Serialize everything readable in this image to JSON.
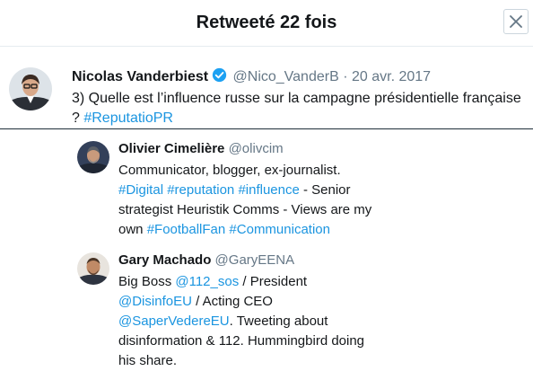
{
  "modal": {
    "title": "Retweeté 22 fois",
    "close_label": "×"
  },
  "tweet": {
    "author_name": "Nicolas Vanderbiest",
    "handle": "@Nico_VanderB",
    "separator": "·",
    "date": "20 avr. 2017",
    "text": "3) Quelle est l’influence russe sur la campagne présidentielle française ? ",
    "hashtag": "#ReputatioPR",
    "verified_icon": "verified-badge-icon",
    "accent_color": "#1b95e0"
  },
  "retweeters": [
    {
      "name": "Olivier Cimelière",
      "handle": "@olivcim",
      "bio": {
        "t1": "Communicator, blogger, ex-journalist.",
        "h1": "#Digital",
        "h2": "#reputation",
        "h3": "#influence",
        "t2": " - Senior strategist Heuristik Comms - Views are my own ",
        "h4": "#FootballFan",
        "h5": "#Communication"
      }
    },
    {
      "name": "Gary Machado",
      "handle": "@GaryEENA",
      "bio": {
        "t1": "Big Boss ",
        "m1": "@112_sos",
        "t2": " / President ",
        "m2": "@DisinfoEU",
        "t3": " / Acting CEO ",
        "m3": "@SaperVedereEU",
        "t4": ". Tweeting about disinformation & 112. Hummingbird doing his share."
      }
    }
  ]
}
